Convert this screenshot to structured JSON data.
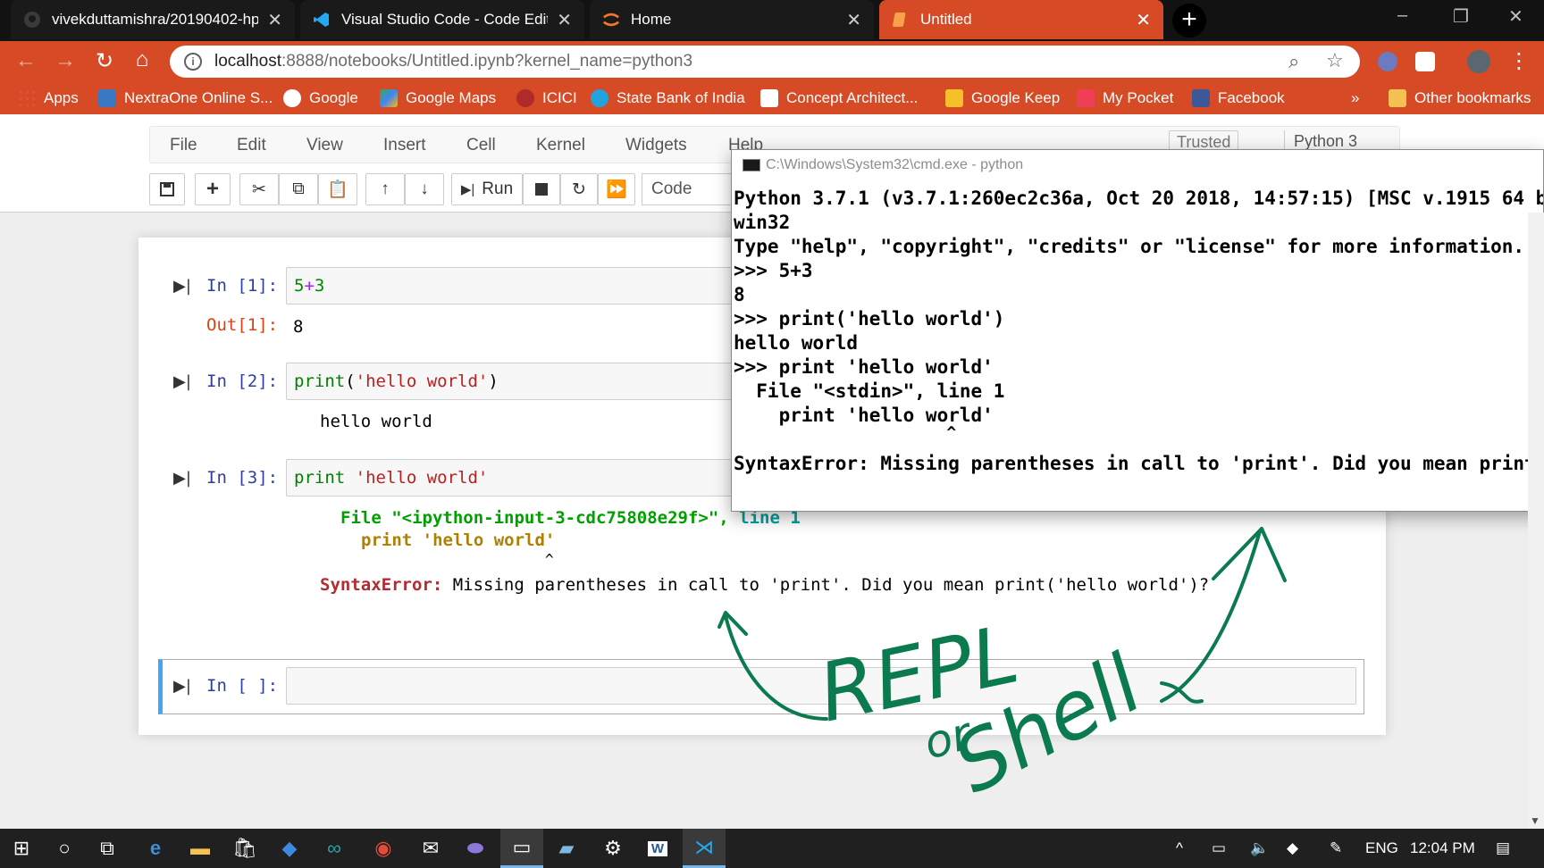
{
  "browser": {
    "tabs": [
      {
        "title": "vivekduttamishra/20190402-hp-p",
        "icon": "github-icon",
        "state": "inactive"
      },
      {
        "title": "Visual Studio Code - Code Editin",
        "icon": "vscode-icon",
        "state": "inactive"
      },
      {
        "title": "Home",
        "icon": "jupyter-icon",
        "state": "inactive"
      },
      {
        "title": "Untitled",
        "icon": "jupyter-notebook-icon",
        "state": "active"
      }
    ],
    "url_host": "localhost",
    "url_path": ":8888/notebooks/Untitled.ipynb?kernel_name=python3",
    "bookmarks": [
      {
        "label": "Apps",
        "icon": "apps-grid-icon"
      },
      {
        "label": "NextraOne Online S...",
        "icon": "nextraone-icon"
      },
      {
        "label": "Google",
        "icon": "google-icon"
      },
      {
        "label": "Google Maps",
        "icon": "google-maps-icon"
      },
      {
        "label": "ICICI",
        "icon": "icici-icon"
      },
      {
        "label": "State Bank of India",
        "icon": "sbi-icon"
      },
      {
        "label": "Concept Architect...",
        "icon": "gmail-icon"
      },
      {
        "label": "Google Keep",
        "icon": "google-keep-icon"
      },
      {
        "label": "My Pocket",
        "icon": "pocket-icon"
      },
      {
        "label": "Facebook",
        "icon": "facebook-icon"
      }
    ],
    "bookmarks_overflow": "»",
    "other_bookmarks": "Other bookmarks"
  },
  "jupyter": {
    "menu": [
      "File",
      "Edit",
      "View",
      "Insert",
      "Cell",
      "Kernel",
      "Widgets",
      "Help"
    ],
    "trusted": "Trusted",
    "kernel": "Python 3",
    "run_label": "Run",
    "cell_type": "Code",
    "cells": [
      {
        "prompt": "In [1]:",
        "code_a": "5",
        "code_op": "+",
        "code_b": "3",
        "out_prompt": "Out[1]:",
        "output": "8"
      },
      {
        "prompt": "In [2]:",
        "code_fn": "print",
        "code_open": "(",
        "code_str": "'hello world'",
        "code_close": ")",
        "output": "hello world"
      },
      {
        "prompt": "In [3]:",
        "code_kw": "print",
        "code_str": "'hello world'",
        "tb_file_kw": "File",
        "tb_file": "\"<ipython-input-3-cdc75808e29f>\"",
        "tb_sep": ",",
        "tb_line": "line 1",
        "tb_code": "print 'hello world'",
        "tb_caret": "^",
        "error_name": "SyntaxError:",
        "error_msg": "Missing parentheses in call to 'print'. Did you mean print('hello world')?"
      },
      {
        "prompt": "In [ ]:"
      }
    ]
  },
  "cmd": {
    "title": "C:\\Windows\\System32\\cmd.exe - python",
    "lines": [
      "Python 3.7.1 (v3.7.1:260ec2c36a, Oct 20 2018, 14:57:15) [MSC v.1915 64 b",
      "win32",
      "Type \"help\", \"copyright\", \"credits\" or \"license\" for more information.",
      ">>> 5+3",
      "8",
      ">>> print('hello world')",
      "hello world",
      ">>> print 'hello world'",
      "  File \"<stdin>\", line 1",
      "    print 'hello world'",
      "                      ^",
      "SyntaxError: Missing parentheses in call to 'print'. Did you mean print("
    ]
  },
  "annotation": {
    "words": [
      "REPL",
      "or",
      "Shell"
    ],
    "color": "#0b7a4e"
  },
  "taskbar": {
    "language": "ENG",
    "time": "12:04 PM"
  },
  "colors": {
    "chrome_accent": "#d64a25",
    "jupyter_prompt_in": "#303f9f",
    "jupyter_prompt_out": "#d84315",
    "selected_cell_border": "#42a5f5"
  }
}
